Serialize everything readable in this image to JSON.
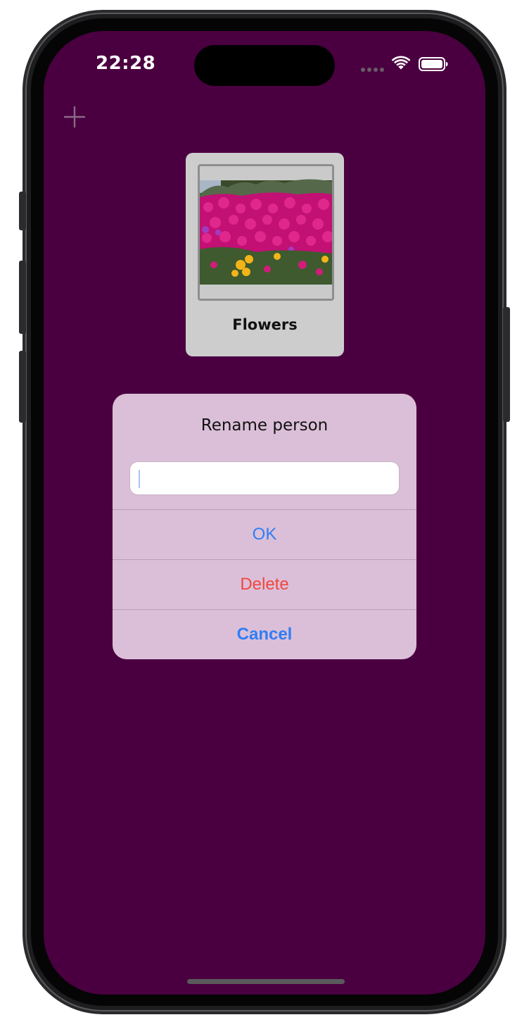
{
  "status_bar": {
    "time": "22:28",
    "icons": [
      "cellular-signal-icon",
      "wifi-icon",
      "battery-icon"
    ]
  },
  "toolbar": {
    "add_icon": "plus-icon"
  },
  "card": {
    "label": "Flowers",
    "image_description": "photo-of-flowers"
  },
  "alert": {
    "title": "Rename person",
    "input_value": "",
    "buttons": {
      "ok": "OK",
      "delete": "Delete",
      "cancel": "Cancel"
    }
  },
  "colors": {
    "screen_background": "#4a0040",
    "alert_background": "#dbbfd8",
    "link_blue": "#2f7ef5",
    "destructive_red": "#f0473e",
    "card_background": "#cdcdcd"
  }
}
